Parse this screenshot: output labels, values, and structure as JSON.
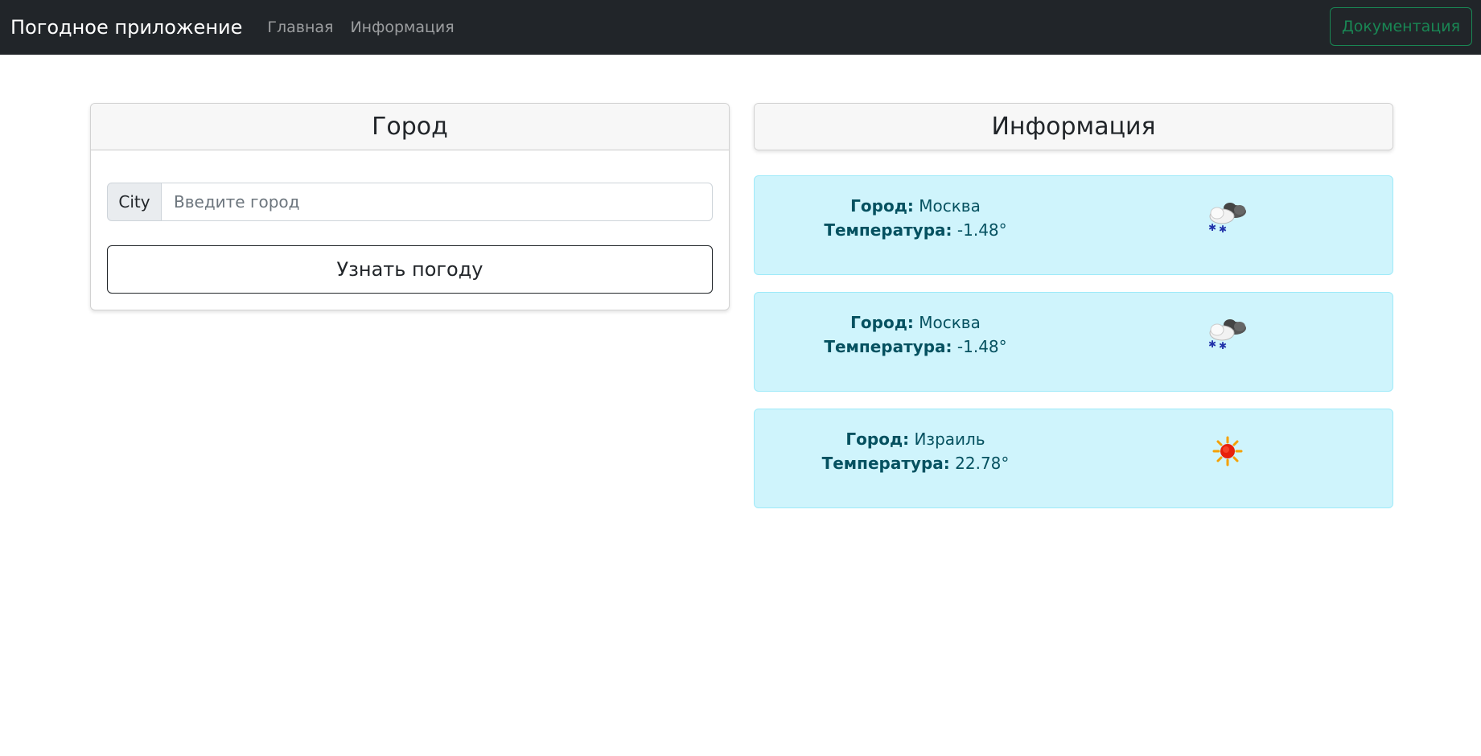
{
  "navbar": {
    "brand": "Погодное приложение",
    "links": [
      "Главная",
      "Информация"
    ],
    "doc_button": "Документация"
  },
  "city_card": {
    "title": "Город",
    "input_prefix": "City",
    "input_placeholder": "Введите город",
    "input_value": "",
    "submit_label": "Узнать погоду"
  },
  "info_card": {
    "title": "Информация"
  },
  "weather": [
    {
      "city_label": "Город:",
      "city": "Москва",
      "temp_label": "Температура:",
      "temp": "-1.48°",
      "icon": "snow-cloud-icon"
    },
    {
      "city_label": "Город:",
      "city": "Москва",
      "temp_label": "Температура:",
      "temp": "-1.48°",
      "icon": "snow-cloud-icon"
    },
    {
      "city_label": "Город:",
      "city": "Израиль",
      "temp_label": "Температура:",
      "temp": "22.78°",
      "icon": "sun-icon"
    }
  ],
  "colors": {
    "navbar_bg": "#212529",
    "success": "#198754",
    "info_bg": "#cff4fc",
    "info_text": "#055160"
  }
}
